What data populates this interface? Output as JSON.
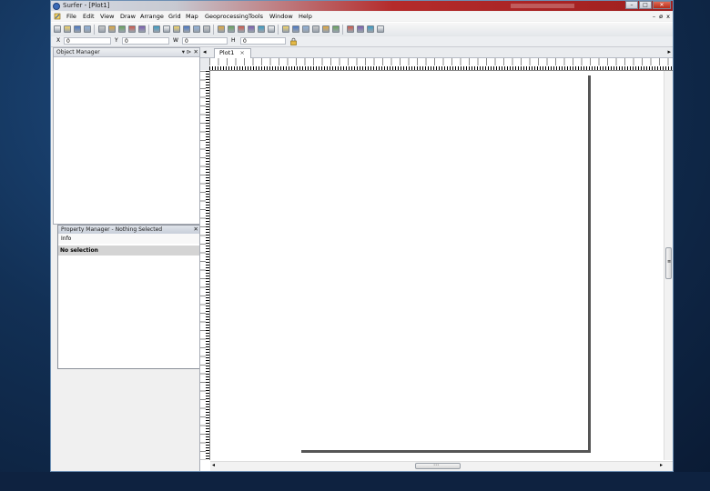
{
  "app": {
    "title": "Surfer - [Plot1]",
    "window_buttons": {
      "minimize": "–",
      "maximize": "□",
      "close": "✕"
    }
  },
  "menubar": {
    "items": [
      "File",
      "Edit",
      "View",
      "Draw",
      "Arrange",
      "Grid",
      "Map",
      "Geoprocessing",
      "Tools",
      "Window",
      "Help"
    ],
    "mdi_buttons": {
      "minimize": "–",
      "restore": "ø",
      "close": "x"
    }
  },
  "coordbar": {
    "x_label": "X",
    "x_value": "0",
    "y_label": "Y",
    "y_value": "0",
    "w_label": "W",
    "w_value": "0",
    "h_label": "H",
    "h_value": "0"
  },
  "object_manager": {
    "title": "Object Manager",
    "controls": "▾ ⊳ ✕"
  },
  "property_manager": {
    "title": "Property Manager - Nothing Selected",
    "close": "✕",
    "info_tool": "Info",
    "no_selection": "No selection"
  },
  "document": {
    "tab_label": "Plot1",
    "tab_close": "×",
    "nav_left": "◂",
    "nav_right": "▸"
  },
  "scroll": {
    "left_arrow": "◂",
    "right_arrow": "▸",
    "h_thumb_grip": "⋯",
    "v_thumb_grip": "≡"
  },
  "colors": {
    "titlebar_accent": "#b42b2b",
    "desktop": "#123055",
    "panel_border": "#a8adb6",
    "selection_bar": "#d4d4d4"
  },
  "toolbar_icons": [
    "new-icon",
    "open-icon",
    "save-icon",
    "print-icon",
    "cut-icon",
    "copy-icon",
    "paste-icon",
    "undo-icon",
    "redo-icon",
    "select-icon",
    "zoom-in-icon",
    "zoom-out-icon",
    "zoom-rect-icon",
    "zoom-fit-icon",
    "pan-icon",
    "refresh-icon",
    "map-contour-icon",
    "map-base-icon",
    "map-post-icon",
    "map-image-icon",
    "map-shaded-icon",
    "map-vector-icon",
    "map-3d-icon",
    "map-watershed-icon",
    "grid-data-icon",
    "grid-slice-icon",
    "grid-volume-icon",
    "grid-blank-icon",
    "grid-convert-icon",
    "grid-filter-icon",
    "grid-math-icon"
  ]
}
